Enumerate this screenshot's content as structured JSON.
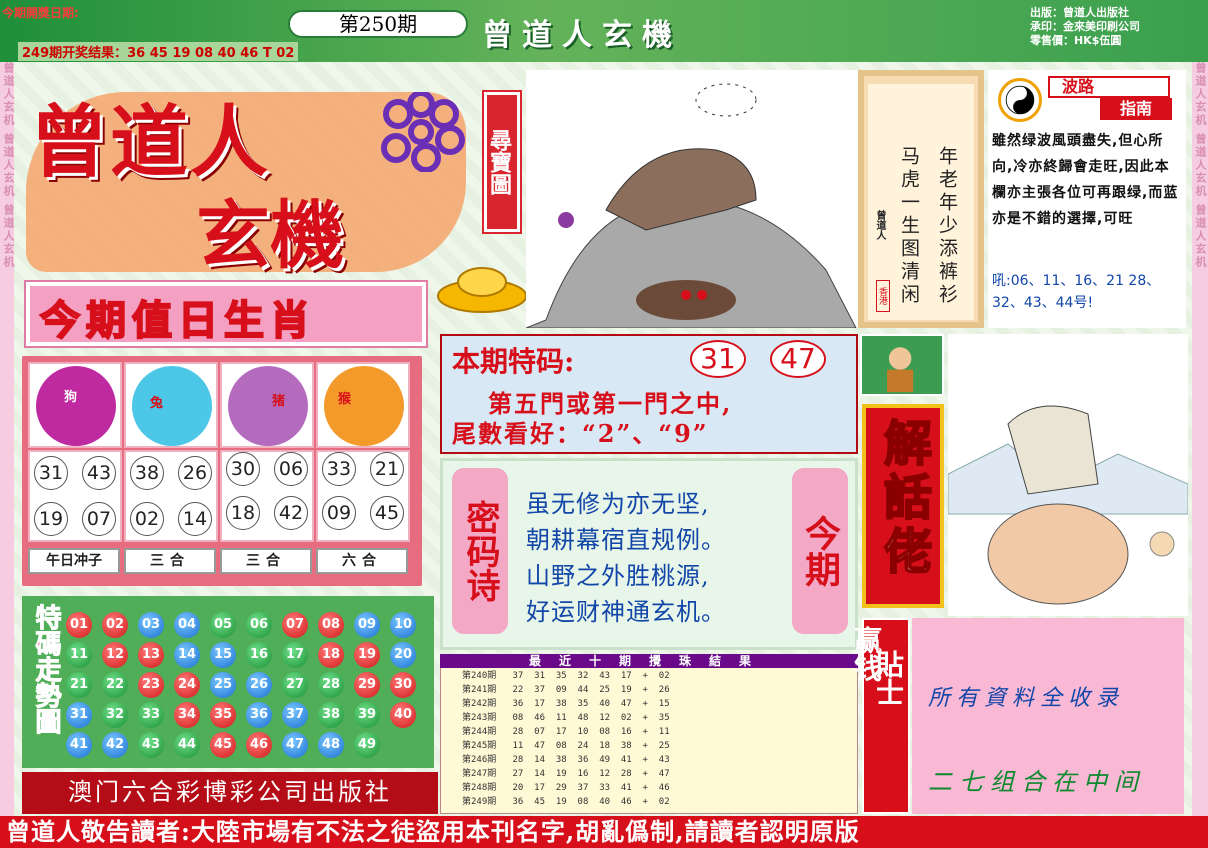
{
  "header": {
    "issue_date_label": "今期開獎日期:",
    "last_result": "249期开奖结果：36 45 19 08 40 46 T 02",
    "issue": "第250期",
    "brand": "曾道人玄機",
    "publisher_lines": [
      "出版：曾道人出版社",
      "承印：金來美印刷公司",
      "零售價：HK$伍圓"
    ]
  },
  "frame_text": "曾道人玄机 曾道人玄机 曾道人玄机",
  "logo": {
    "line1": "曾道人",
    "line2": "玄機",
    "tag": "尋寶圖"
  },
  "zodiac": {
    "title": "今期值日生肖",
    "animals": [
      {
        "name": "狗",
        "icon": "dog-icon",
        "numbers": [
          "31",
          "43",
          "19",
          "07"
        ],
        "label": "午日冲子"
      },
      {
        "name": "兔",
        "icon": "rabbit-icon",
        "numbers": [
          "38",
          "26",
          "02",
          "14"
        ],
        "label": "三合"
      },
      {
        "name": "猪",
        "icon": "pig-icon",
        "numbers": [
          "30",
          "06",
          "18",
          "42"
        ],
        "label": "三合"
      },
      {
        "name": "猴",
        "icon": "monkey-icon",
        "numbers": [
          "33",
          "21",
          "09",
          "45"
        ],
        "label": "六合"
      }
    ]
  },
  "balls": {
    "title": "特碼走勢圖",
    "rows": [
      [
        "01",
        "02",
        "03",
        "04",
        "05",
        "06",
        "07",
        "08",
        "09",
        "10"
      ],
      [
        "11",
        "12",
        "13",
        "14",
        "15",
        "16",
        "17",
        "18",
        "19",
        "20"
      ],
      [
        "21",
        "22",
        "23",
        "24",
        "25",
        "26",
        "27",
        "28",
        "29",
        "30"
      ],
      [
        "31",
        "32",
        "33",
        "34",
        "35",
        "36",
        "37",
        "38",
        "39",
        "40"
      ],
      [
        "41",
        "42",
        "43",
        "44",
        "45",
        "46",
        "47",
        "48",
        "49"
      ]
    ],
    "colors": {
      "red": "#d11818",
      "blue": "#1a6fd1",
      "green": "#1a8f34"
    }
  },
  "bottom_publisher": "澳门六合彩博彩公司出版社",
  "special": {
    "title": "本期特码:",
    "num1": "31",
    "num2": "47",
    "line1": "第五門或第一門之中,",
    "line2": "尾數看好：“2”、“9”"
  },
  "poem": {
    "left": "密码诗",
    "right": "今期",
    "lines": [
      "虽无修为亦无坚,",
      "朝耕幕宿直规例。",
      "山野之外胜桃源,",
      "好运财神通玄机。"
    ]
  },
  "results": {
    "title": "最近十期攪珠結果",
    "rows": [
      "第240期   37  31  35  32  43  17  +  02",
      "第241期   22  37  09  44  25  19  +  26",
      "第242期   36  17  38  35  40  47  +  15",
      "第243期   08  46  11  48  12  02  +  35",
      "第244期   28  07  17  10  08  16  +  11",
      "第245期   11  47  08  24  18  38  +  25",
      "第246期   28  14  38  36  49  41  +  43",
      "第247期   27  14  19  16  12  28  +  47",
      "第248期   20  17  29  37  33  41  +  46",
      "第249期   36  45  19  08  40  46  +  02"
    ]
  },
  "scroll": {
    "col1": "年老年少添裤衫",
    "col2": "马虎一生图清闲",
    "mark": "曾道人",
    "seal": "香港"
  },
  "bolu": {
    "tag1": "波路",
    "tag2": "指南",
    "text": "雖然绿波風頭盡失,但心所向,冷亦終歸會走旺,因此本欄亦主張各位可再跟绿,而蓝亦是不錯的選擇,可旺",
    "numbers": "吼:06、11、16、21 28、32、43、44号!"
  },
  "jiehua": "解話佬",
  "tips": {
    "tag_a": "赢钱",
    "tag_b": "貼士",
    "line1": "所有資料全收录",
    "line2": "二七组合在中间"
  },
  "footer": "曾道人敬告讀者:大陸市場有不法之徒盜用本刊名字,胡亂僞制,請讀者認明原版"
}
